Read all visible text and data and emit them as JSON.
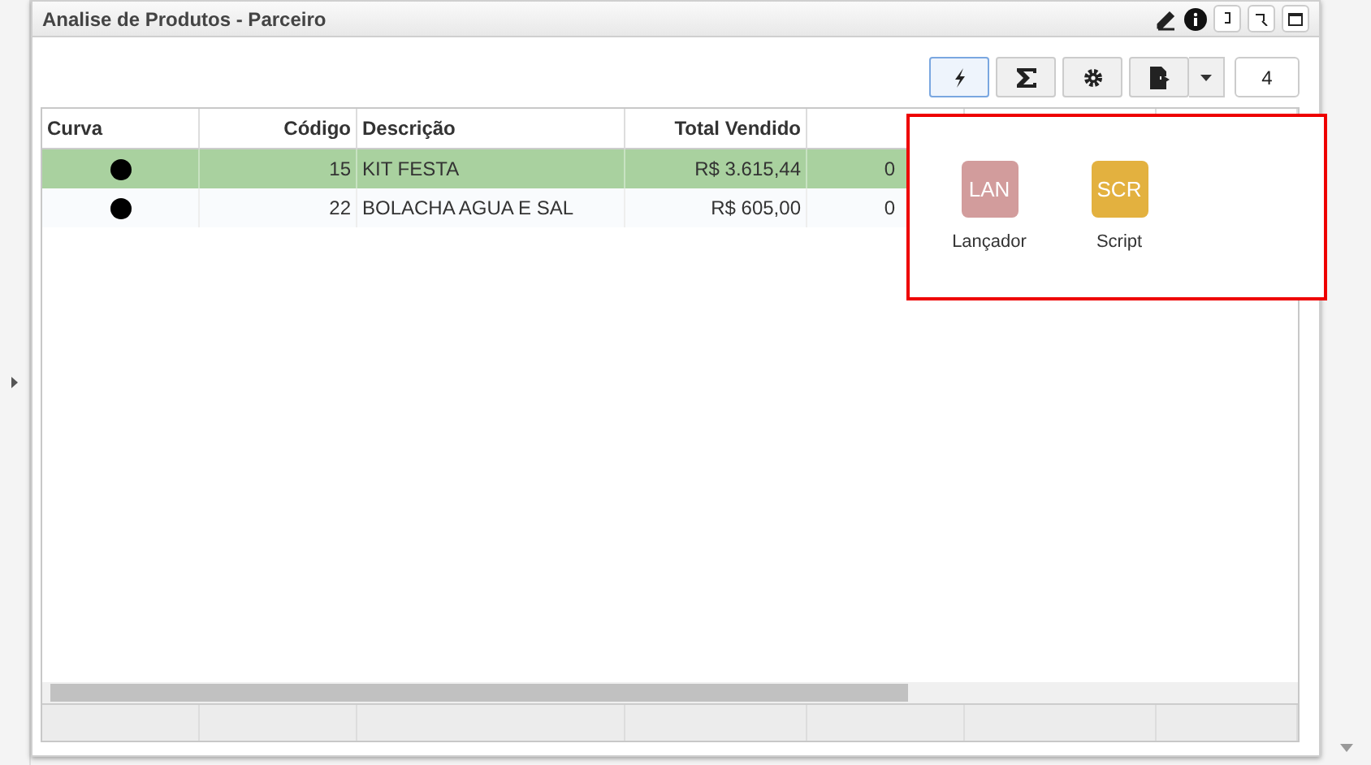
{
  "window": {
    "title": "Analise de Produtos - Parceiro"
  },
  "toolbar": {
    "buttons": [
      {
        "kind": "bolt",
        "selected": true
      },
      {
        "kind": "sigma",
        "selected": false
      },
      {
        "kind": "gear",
        "selected": false
      },
      {
        "kind": "export",
        "selected": false
      }
    ],
    "badge": "4"
  },
  "table": {
    "columns": [
      "Curva",
      "Código",
      "Descrição",
      "Total Vendido"
    ],
    "rows": [
      {
        "codigo": "15",
        "descricao": "KIT FESTA",
        "total": "R$ 3.615,44",
        "column_5": "0",
        "selected": true
      },
      {
        "codigo": "22",
        "descricao": "BOLACHA AGUA E SAL",
        "total": "R$ 605,00",
        "column_5": "0",
        "selected": false
      }
    ]
  },
  "popup": {
    "items": [
      {
        "abbr": "LAN",
        "label": "Lançador",
        "color": "#d29c9c"
      },
      {
        "abbr": "SCR",
        "label": "Script",
        "color": "#e3b13f"
      }
    ]
  }
}
